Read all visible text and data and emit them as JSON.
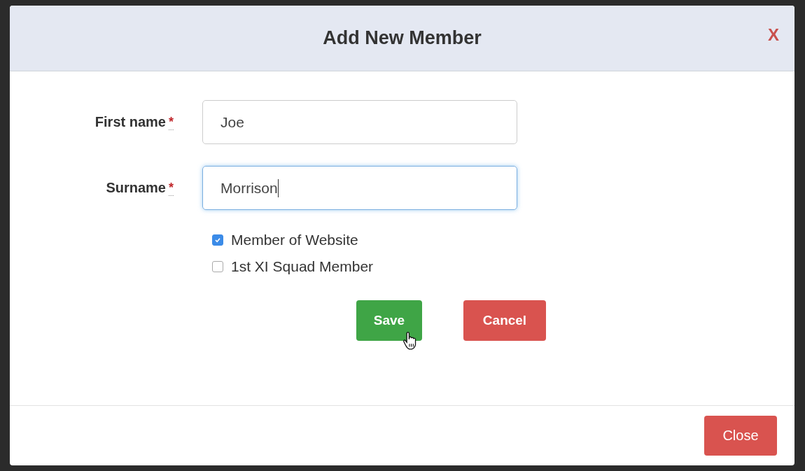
{
  "dialog": {
    "title": "Add New Member",
    "close_glyph": "X"
  },
  "fields": [
    {
      "label": "First name",
      "required_mark": "*",
      "value": "Joe",
      "focused": false
    },
    {
      "label": "Surname",
      "required_mark": "*",
      "value": "Morrison",
      "focused": true
    }
  ],
  "checkboxes": [
    {
      "label": "Member of Website",
      "checked": true
    },
    {
      "label": "1st XI Squad Member",
      "checked": false
    }
  ],
  "actions": [
    {
      "label": "Save",
      "kind": "success",
      "hovered": true
    },
    {
      "label": "Cancel",
      "kind": "danger",
      "hovered": false
    }
  ],
  "footer": {
    "button": "Close"
  }
}
